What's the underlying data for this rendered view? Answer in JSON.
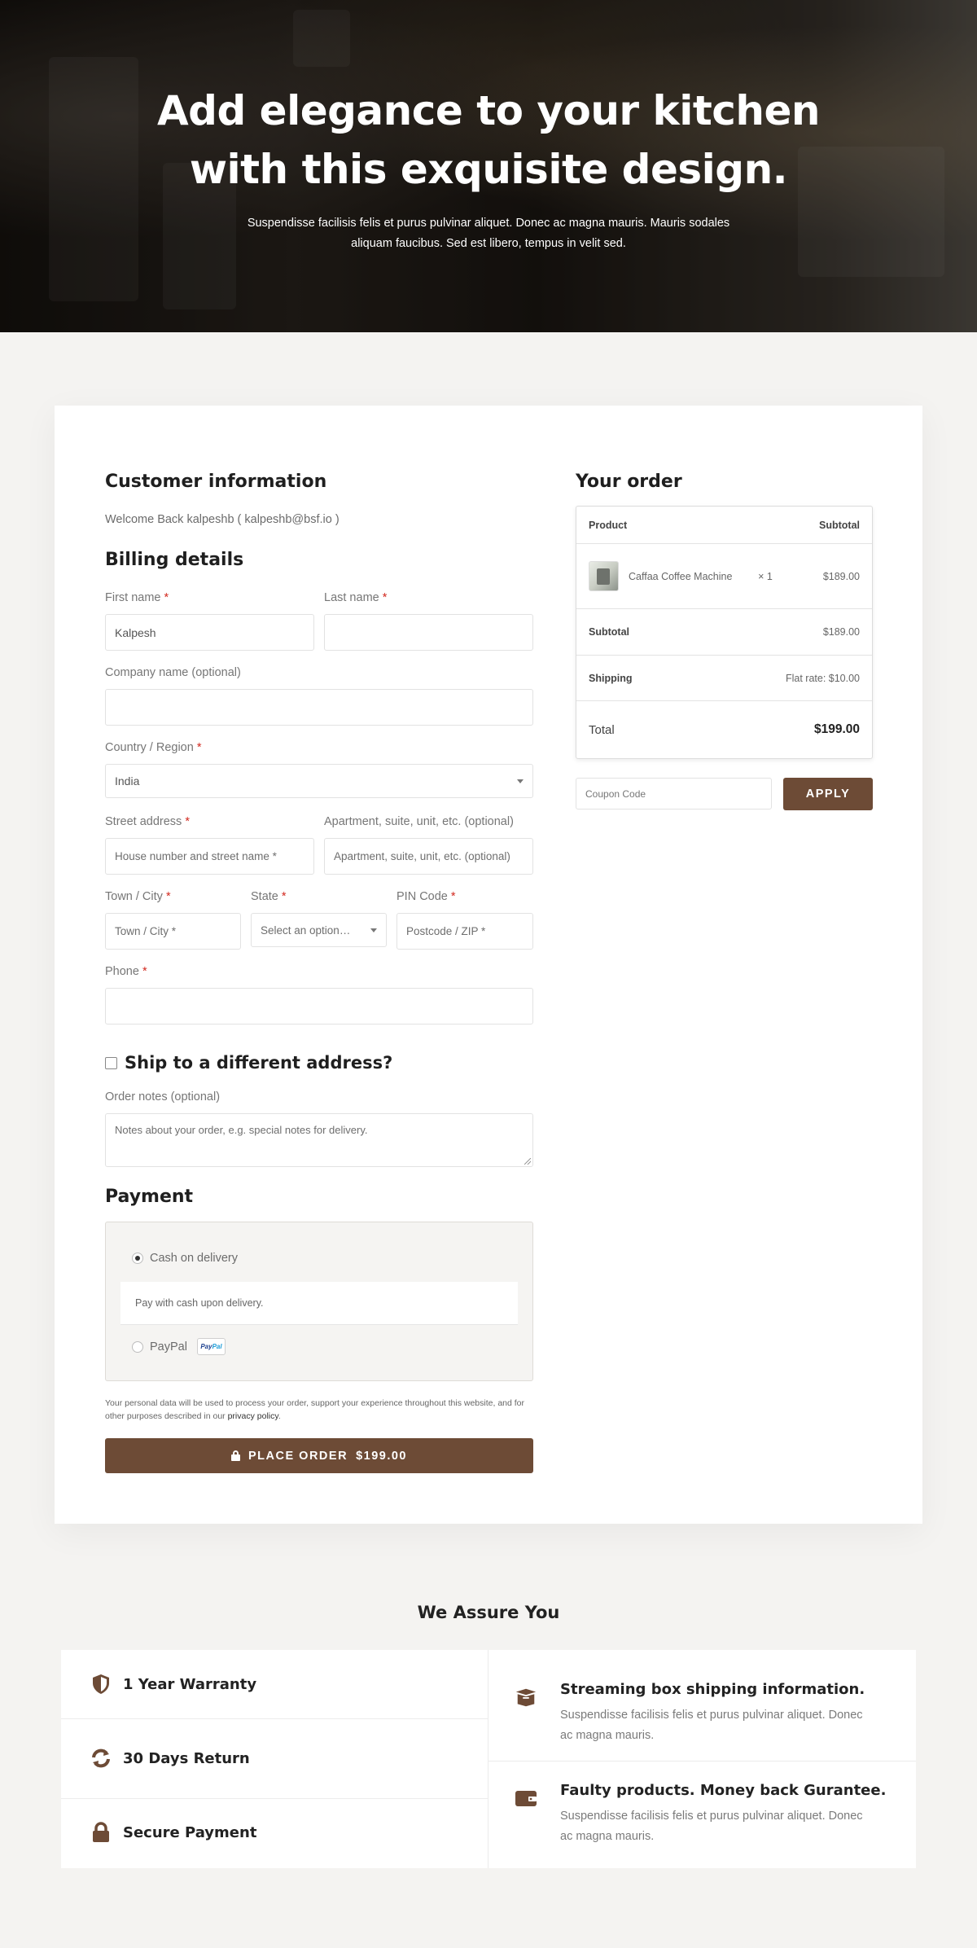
{
  "hero": {
    "title_line1": "Add elegance to your kitchen",
    "title_line2": "with this exquisite design.",
    "subtitle_line1": "Suspendisse facilisis felis et purus pulvinar aliquet. Donec ac magna mauris. Mauris sodales",
    "subtitle_line2": "aliquam faucibus. Sed est libero, tempus in velit sed."
  },
  "customer": {
    "title": "Customer information",
    "welcome": "Welcome Back kalpeshb ( kalpeshb@bsf.io )"
  },
  "billing": {
    "title": "Billing details",
    "required_mark": "*",
    "first_name": {
      "label": "First name",
      "value": "Kalpesh"
    },
    "last_name": {
      "label": "Last name",
      "value": ""
    },
    "company": {
      "label": "Company name (optional)",
      "value": ""
    },
    "country": {
      "label": "Country / Region",
      "value": "India"
    },
    "street": {
      "label": "Street address",
      "placeholder": "House number and street name *"
    },
    "apartment": {
      "label": "Apartment, suite, unit, etc. (optional)",
      "placeholder": "Apartment, suite, unit, etc. (optional)"
    },
    "town": {
      "label": "Town / City",
      "placeholder": "Town / City *"
    },
    "state": {
      "label": "State",
      "placeholder": "Select an option…"
    },
    "pin": {
      "label": "PIN Code",
      "placeholder": "Postcode / ZIP *"
    },
    "phone": {
      "label": "Phone",
      "value": ""
    }
  },
  "shipping": {
    "label": "Ship to a different address?",
    "checked": false
  },
  "notes": {
    "label": "Order notes (optional)",
    "placeholder": "Notes about your order, e.g. special notes for delivery."
  },
  "payment": {
    "title": "Payment",
    "methods": [
      {
        "label": "Cash on delivery",
        "selected": true,
        "description": "Pay with cash upon delivery."
      },
      {
        "label": "PayPal",
        "selected": false,
        "badge_a": "Pay",
        "badge_b": "Pal"
      }
    ],
    "privacy_text": "Your personal data will be used to process your order, support your experience throughout this website, and for other purposes described in our",
    "privacy_link": "privacy policy",
    "privacy_end": ".",
    "place_order": "PLACE ORDER",
    "place_order_amount": "$199.00"
  },
  "order": {
    "title": "Your order",
    "col_product": "Product",
    "col_subtotal": "Subtotal",
    "items": [
      {
        "name": "Caffaa Coffee Machine",
        "qty": "× 1",
        "price": "$189.00"
      }
    ],
    "subtotal_label": "Subtotal",
    "subtotal_value": "$189.00",
    "shipping_label": "Shipping",
    "shipping_value": "Flat rate: $10.00",
    "total_label": "Total",
    "total_value": "$199.00",
    "coupon_placeholder": "Coupon Code",
    "apply": "APPLY"
  },
  "assure": {
    "title": "We Assure You",
    "items": [
      {
        "label": "1 Year Warranty",
        "icon": "shield-icon"
      },
      {
        "label": "30 Days Return",
        "icon": "refresh-icon"
      },
      {
        "label": "Secure Payment",
        "icon": "lock-icon"
      }
    ],
    "features": [
      {
        "title": "Streaming box shipping information.",
        "desc_line1": "Suspendisse facilisis felis et purus pulvinar aliquet. Donec",
        "desc_line2": "ac magna mauris.",
        "icon": "box-icon"
      },
      {
        "title": "Faulty products. Money back Gurantee.",
        "desc_line1": "Suspendisse facilisis felis et purus pulvinar aliquet. Donec",
        "desc_line2": "ac magna mauris.",
        "icon": "wallet-icon"
      }
    ]
  },
  "colors": {
    "accent": "#6d4b36",
    "required": "#d2291f",
    "background": "#f4f3f1"
  }
}
